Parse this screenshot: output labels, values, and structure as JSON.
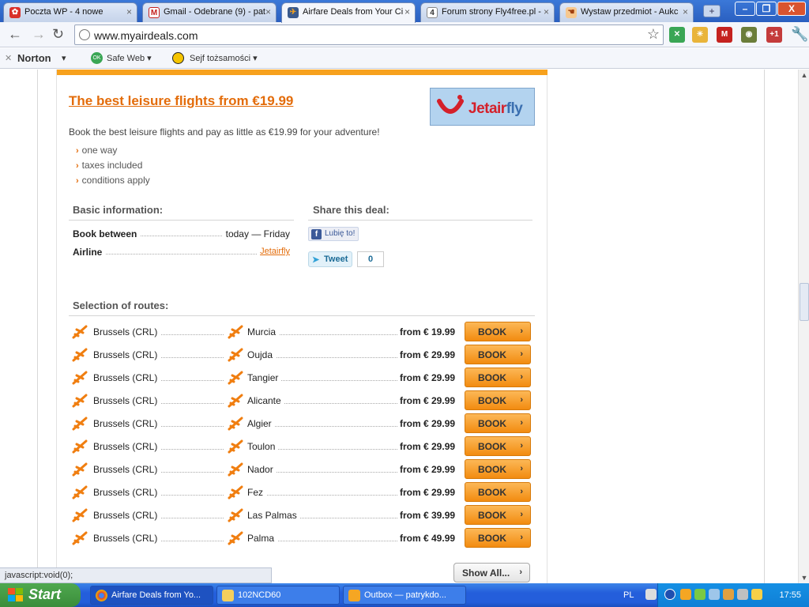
{
  "browser": {
    "tabs": [
      {
        "title": "Poczta WP - 4 nowe",
        "icon": "flower-icon",
        "color": "#d9302a"
      },
      {
        "title": "Gmail - Odebrane (9) - pat",
        "icon": "gmail-icon",
        "color": "#c5221f"
      },
      {
        "title": "Airfare Deals from Your Ci",
        "icon": "plane-icon",
        "color": "#f0a020"
      },
      {
        "title": "Forum strony Fly4free.pl -",
        "icon": "number-four-icon",
        "color": "#333333"
      },
      {
        "title": "Wystaw przedmiot - Aukc",
        "icon": "hand-icon",
        "color": "#e07020"
      }
    ],
    "new_tab": "+",
    "window_buttons": [
      "–",
      "❐",
      "X"
    ],
    "url": "www.myairdeals.com"
  },
  "norton": {
    "brand": "Norton",
    "safe_web": "Safe Web",
    "safe_web_badge": "OK",
    "identity_safe": "Sejf tożsamości"
  },
  "deal": {
    "title": "The best leisure flights from €19.99",
    "logo_text_a": "Jetair",
    "logo_text_b": "fly",
    "description": "Book the best leisure flights and pay as little as €19.99 for your adventure!",
    "features": [
      "one way",
      "taxes included",
      "conditions apply"
    ],
    "basic_info_heading": "Basic information:",
    "share_heading": "Share this deal:",
    "book_between_label": "Book between",
    "book_between_value": "today — Friday",
    "airline_label": "Airline",
    "airline_value": "Jetairfly",
    "fb_like": "Lubię to!",
    "tweet": "Tweet",
    "tweet_count": "0",
    "routes_heading": "Selection of routes:",
    "routes": [
      {
        "from": "Brussels (CRL)",
        "to": "Murcia",
        "price": "from € 19.99"
      },
      {
        "from": "Brussels (CRL)",
        "to": "Oujda",
        "price": "from € 29.99"
      },
      {
        "from": "Brussels (CRL)",
        "to": "Tangier",
        "price": "from € 29.99"
      },
      {
        "from": "Brussels (CRL)",
        "to": "Alicante",
        "price": "from € 29.99"
      },
      {
        "from": "Brussels (CRL)",
        "to": "Algier",
        "price": "from € 29.99"
      },
      {
        "from": "Brussels (CRL)",
        "to": "Toulon",
        "price": "from € 29.99"
      },
      {
        "from": "Brussels (CRL)",
        "to": "Nador",
        "price": "from € 29.99"
      },
      {
        "from": "Brussels (CRL)",
        "to": "Fez",
        "price": "from € 29.99"
      },
      {
        "from": "Brussels (CRL)",
        "to": "Las Palmas",
        "price": "from € 39.99"
      },
      {
        "from": "Brussels (CRL)",
        "to": "Palma",
        "price": "from € 49.99"
      }
    ],
    "book_label": "BOOK",
    "show_all": "Show All..."
  },
  "status_text": "javascript:void(0);",
  "taskbar": {
    "start": "Start",
    "items": [
      {
        "label": "Airfare Deals from Yo...",
        "icon": "chrome-icon"
      },
      {
        "label": "102NCD60",
        "icon": "folder-icon"
      },
      {
        "label": "Outbox — patrykdo...",
        "icon": "outlook-icon"
      }
    ],
    "language": "PL",
    "clock": "17:55"
  },
  "colors": {
    "accent_orange": "#f7a11d",
    "link_orange": "#e36c0a",
    "taskbar_blue": "#245edb"
  }
}
